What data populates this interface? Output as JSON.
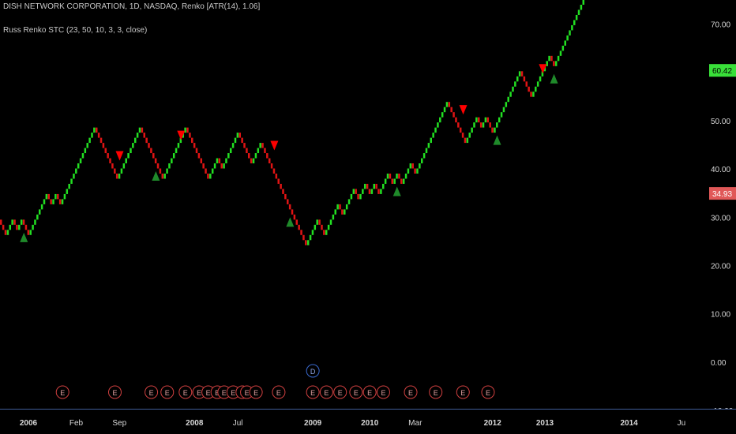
{
  "chart_data": {
    "type": "renko",
    "title": "DISH NETWORK CORPORATION, 1D, NASDAQ, Renko [ATR(14), 1.06]",
    "study": "Russ Renko STC (23, 50, 10, 3, 3, close)",
    "ylim": [
      -10,
      75
    ],
    "y_ticks": [
      -10,
      0,
      10,
      20,
      30,
      40,
      50,
      60,
      70
    ],
    "y_tick_labels": [
      "-10.00",
      "0.00",
      "10.00",
      "20.00",
      "30.00",
      "40.00",
      "50.00",
      "60.00",
      "70.00"
    ],
    "x_ticks": [
      {
        "label": "2006",
        "bold": true,
        "brick": 6
      },
      {
        "label": "Feb",
        "bold": false,
        "brick": 17
      },
      {
        "label": "Sep",
        "bold": false,
        "brick": 27
      },
      {
        "label": "2008",
        "bold": true,
        "brick": 44
      },
      {
        "label": "Jul",
        "bold": false,
        "brick": 54
      },
      {
        "label": "2009",
        "bold": true,
        "brick": 71
      },
      {
        "label": "2010",
        "bold": true,
        "brick": 84
      },
      {
        "label": "Mar",
        "bold": false,
        "brick": 94
      },
      {
        "label": "2012",
        "bold": true,
        "brick": 112
      },
      {
        "label": "2013",
        "bold": true,
        "brick": 124
      },
      {
        "label": "2014",
        "bold": true,
        "brick": 143
      },
      {
        "label": "Ju",
        "bold": false,
        "brick": 155
      }
    ],
    "brick_size": 1.06,
    "bricks": [
      {
        "n": -3
      },
      {
        "n": 3
      },
      {
        "n": -2
      },
      {
        "n": 2
      },
      {
        "n": -3
      },
      {
        "n": 8
      },
      {
        "n": -2
      },
      {
        "n": 2
      },
      {
        "n": -2
      },
      {
        "n": 15
      },
      {
        "n": -10
      },
      {
        "n": 10
      },
      {
        "n": -10
      },
      {
        "n": 10
      },
      {
        "n": -10
      },
      {
        "n": 4
      },
      {
        "n": -2
      },
      {
        "n": 7
      },
      {
        "n": -6
      },
      {
        "n": 4
      },
      {
        "n": -20
      },
      {
        "n": 5
      },
      {
        "n": -3
      },
      {
        "n": 6
      },
      {
        "n": -2
      },
      {
        "n": 5
      },
      {
        "n": -2
      },
      {
        "n": 3
      },
      {
        "n": -2
      },
      {
        "n": 2
      },
      {
        "n": -2
      },
      {
        "n": 4
      },
      {
        "n": -2
      },
      {
        "n": 2
      },
      {
        "n": -2
      },
      {
        "n": 4
      },
      {
        "n": -2
      },
      {
        "n": 14
      },
      {
        "n": -8
      },
      {
        "n": 5
      },
      {
        "n": -2
      },
      {
        "n": 2
      },
      {
        "n": -3
      },
      {
        "n": 12
      },
      {
        "n": -5
      },
      {
        "n": 8
      },
      {
        "n": -2
      },
      {
        "n": 24
      },
      {
        "n": -2
      },
      {
        "n": 3
      },
      {
        "n": -2
      },
      {
        "n": 20
      },
      {
        "n": -4
      },
      {
        "n": 3
      },
      {
        "n": -2
      },
      {
        "n": 3
      },
      {
        "n": -2
      }
    ],
    "last_price": "60.42",
    "stc_level": "34.93",
    "colors": {
      "up": "#22e022",
      "down": "#e01414",
      "buy_marker": "#1f8a2a",
      "sell_marker": "#ff0000",
      "event_marker": "#d04040",
      "dividend_marker": "#3a6ad0",
      "axis_text": "#d8d8d8",
      "last_price_bg": "#39e039",
      "stc_bg": "#e05858"
    },
    "buy_signals": [
      5,
      35,
      66,
      90,
      113,
      126
    ],
    "sell_signals": [
      26,
      40,
      61,
      104,
      122,
      142,
      157
    ],
    "event_marker_label": "E",
    "dividend_marker_label": "D",
    "event_markers": [
      14,
      26,
      34,
      38,
      42,
      45,
      47,
      49,
      51,
      53,
      55,
      56,
      58,
      63,
      71,
      74,
      77,
      81,
      84,
      87,
      93,
      99,
      105,
      111
    ],
    "dividend_marker": 71
  }
}
